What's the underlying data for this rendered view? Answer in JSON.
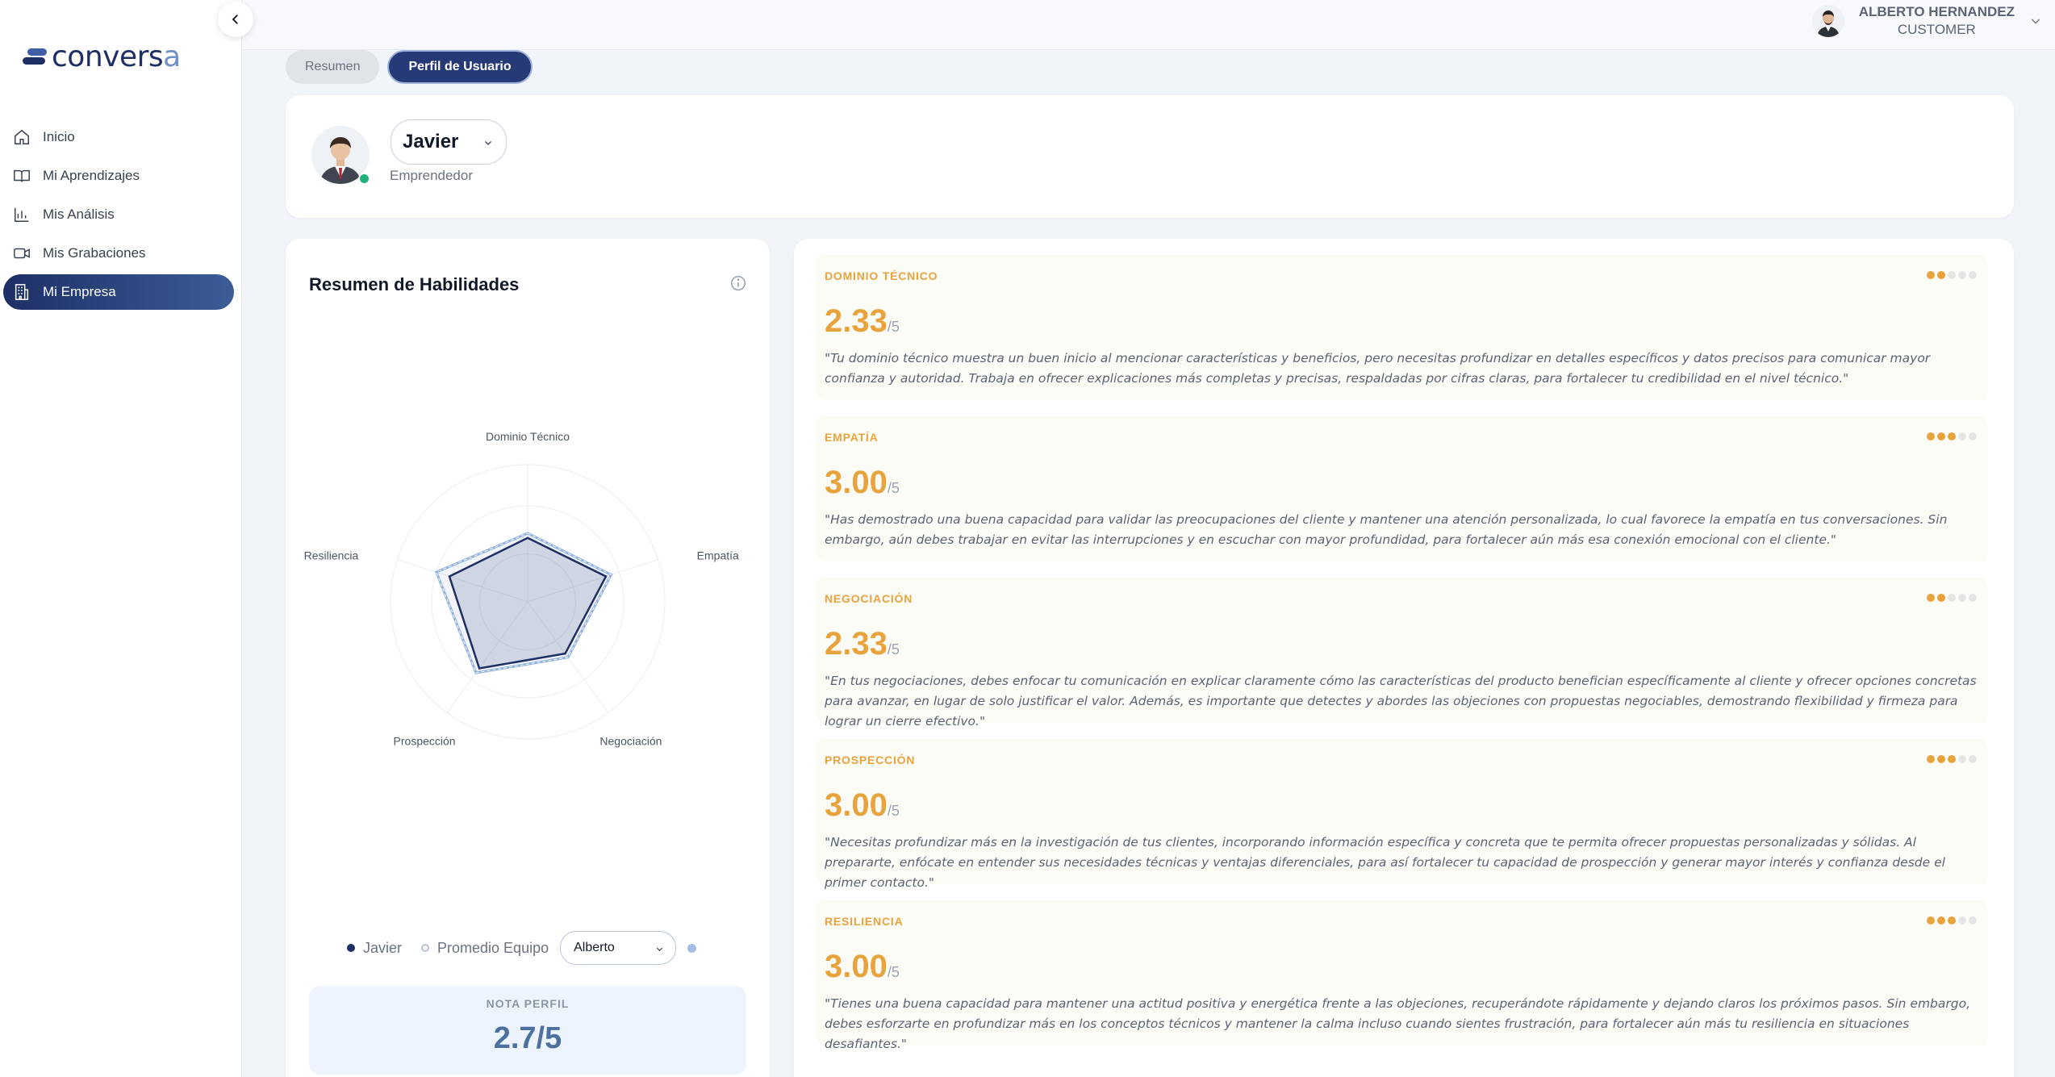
{
  "brand": {
    "logo_main": "convers",
    "logo_end": "a"
  },
  "sidebar": {
    "items": [
      {
        "label": "Inicio",
        "icon": "home-icon",
        "active": false
      },
      {
        "label": "Mi Aprendizajes",
        "icon": "book-icon",
        "active": false
      },
      {
        "label": "Mis Análisis",
        "icon": "bar-chart-icon",
        "active": false
      },
      {
        "label": "Mis Grabaciones",
        "icon": "video-icon",
        "active": false
      },
      {
        "label": "Mi Empresa",
        "icon": "building-icon",
        "active": true
      }
    ]
  },
  "user": {
    "name": "ALBERTO HERNANDEZ",
    "role": "CUSTOMER"
  },
  "tabs": [
    {
      "label": "Resumen",
      "active": false
    },
    {
      "label": "Perfil de Usuario",
      "active": true
    }
  ],
  "profile": {
    "selected_user": "Javier",
    "role": "Emprendedor",
    "status_color": "#22b07d"
  },
  "skills_summary": {
    "title": "Resumen de Habilidades",
    "legend_primary": "Javier",
    "legend_team": "Promedio Equipo",
    "compare_selected": "Alberto",
    "score_label": "NOTA PERFIL",
    "score_value": "2.7/5"
  },
  "chart_data": {
    "type": "radar",
    "axes": [
      "Dominio Técnico",
      "Empatía",
      "Negociación",
      "Prospección",
      "Resiliencia"
    ],
    "max": 5,
    "series": [
      {
        "name": "Javier",
        "values": [
          2.33,
          3.0,
          2.33,
          3.0,
          3.0
        ],
        "color": "#1e2f66"
      },
      {
        "name": "Promedio Equipo",
        "values": [
          2.5,
          3.2,
          2.5,
          3.2,
          3.5
        ],
        "color": "#8fb0e0"
      }
    ]
  },
  "feedback": [
    {
      "name": "DOMINIO TÉCNICO",
      "score": "2.33",
      "out_of": "/5",
      "dots_on": 2,
      "text": "\"Tu dominio técnico muestra un buen inicio al mencionar características y beneficios, pero necesitas profundizar en detalles específicos y datos precisos para comunicar mayor confianza y autoridad. Trabaja en ofrecer explicaciones más completas y precisas, respaldadas por cifras claras, para fortalecer tu credibilidad en el nivel técnico.\""
    },
    {
      "name": "EMPATÍA",
      "score": "3.00",
      "out_of": "/5",
      "dots_on": 3,
      "text": "\"Has demostrado una buena capacidad para validar las preocupaciones del cliente y mantener una atención personalizada, lo cual favorece la empatía en tus conversaciones. Sin embargo, aún debes trabajar en evitar las interrupciones y en escuchar con mayor profundidad, para fortalecer aún más esa conexión emocional con el cliente.\""
    },
    {
      "name": "NEGOCIACIÓN",
      "score": "2.33",
      "out_of": "/5",
      "dots_on": 2,
      "text": "\"En tus negociaciones, debes enfocar tu comunicación en explicar claramente cómo las características del producto benefician específicamente al cliente y ofrecer opciones concretas para avanzar, en lugar de solo justificar el valor. Además, es importante que detectes y abordes las objeciones con propuestas negociables, demostrando flexibilidad y firmeza para lograr un cierre efectivo.\""
    },
    {
      "name": "PROSPECCIÓN",
      "score": "3.00",
      "out_of": "/5",
      "dots_on": 3,
      "text": "\"Necesitas profundizar más en la investigación de tus clientes, incorporando información específica y concreta que te permita ofrecer propuestas personalizadas y sólidas. Al prepararte, enfócate en entender sus necesidades técnicas y ventajas diferenciales, para así fortalecer tu capacidad de prospección y generar mayor interés y confianza desde el primer contacto.\""
    },
    {
      "name": "RESILIENCIA",
      "score": "3.00",
      "out_of": "/5",
      "dots_on": 3,
      "text": "\"Tienes una buena capacidad para mantener una actitud positiva y energética frente a las objeciones, recuperándote rápidamente y dejando claros los próximos pasos. Sin embargo, debes esforzarte en profundizar más en los conceptos técnicos y mantener la calma incluso cuando sientes frustración, para fortalecer aún más tu resiliencia en situaciones desafiantes.\""
    }
  ]
}
